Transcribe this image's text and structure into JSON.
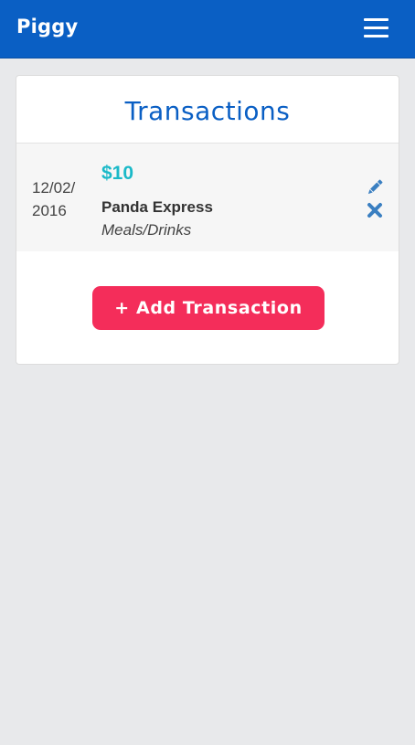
{
  "navbar": {
    "brand": "Piggy",
    "menu_icon": "hamburger-menu-icon",
    "background": "#0a5fc4"
  },
  "panel": {
    "title": "Transactions"
  },
  "transactions": [
    {
      "date": "12/02/2016",
      "amount": "$10",
      "merchant": "Panda Express",
      "category": "Meals/Drinks",
      "edit_icon": "pencil-icon",
      "delete_icon": "close-x-icon"
    }
  ],
  "actions": {
    "add_label": "+ Add Transaction",
    "add_color": "#f42d5a"
  },
  "colors": {
    "amount": "#1ab9c8",
    "icon": "#3a7fc1",
    "page_background": "#e8e9eb"
  }
}
